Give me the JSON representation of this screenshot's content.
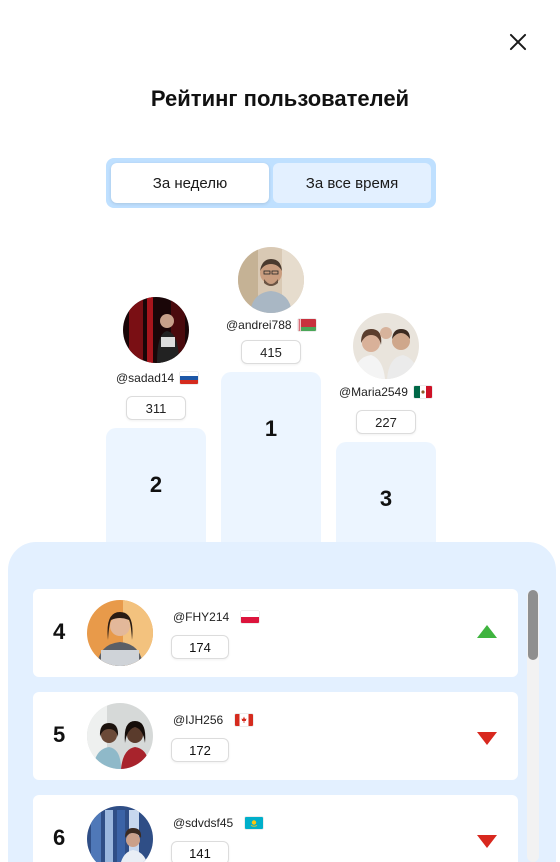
{
  "title": "Рейтинг пользователей",
  "tabs": [
    {
      "label": "За неделю",
      "active": true
    },
    {
      "label": "За все время",
      "active": false
    }
  ],
  "podium": {
    "first": {
      "rank": "1",
      "username": "@andrei788",
      "flag": "belarus-flag",
      "score": "415"
    },
    "second": {
      "rank": "2",
      "username": "@sadad14",
      "flag": "russia-flag",
      "score": "311"
    },
    "third": {
      "rank": "3",
      "username": "@Maria2549",
      "flag": "mexico-flag",
      "score": "227"
    }
  },
  "list": [
    {
      "rank": "4",
      "username": "@FHY214",
      "flag": "poland-flag",
      "score": "174",
      "trend": "up"
    },
    {
      "rank": "5",
      "username": "@IJH256",
      "flag": "canada-flag",
      "score": "172",
      "trend": "down"
    },
    {
      "rank": "6",
      "username": "@sdvdsf45",
      "flag": "kazakhstan-flag",
      "score": "141",
      "trend": "down"
    }
  ],
  "colors": {
    "switcher_bg": "#bfe0ff",
    "pedestal": "#ecf5ff",
    "list_panel": "#e3f0ff",
    "trend_up": "#3fb43f",
    "trend_down": "#d8281e"
  }
}
